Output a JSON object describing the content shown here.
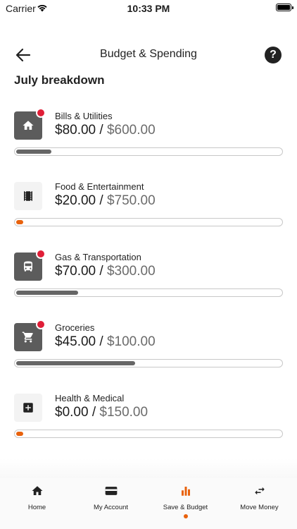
{
  "status_bar": {
    "carrier": "Carrier",
    "time": "10:33 PM"
  },
  "header": {
    "title": "Budget & Spending",
    "back_icon": "arrow-left-icon",
    "help_label": "?"
  },
  "section_title": "July breakdown",
  "colors": {
    "accent": "#e8620d",
    "fill_dark": "#666666",
    "alert": "#e01e37",
    "icon_dark_bg": "#5c5c5c",
    "icon_light_bg": "#f3f3f3"
  },
  "budgets": [
    {
      "name": "Bills & Utilities",
      "spent": "$80.00",
      "separator": " / ",
      "limit": "$600.00",
      "icon": "home-icon",
      "icon_style": "dark",
      "alert": true,
      "progress": 0.133
    },
    {
      "name": "Food & Entertainment",
      "spent": "$20.00",
      "separator": " / ",
      "limit": "$750.00",
      "icon": "film-icon",
      "icon_style": "light",
      "alert": false,
      "progress": 0.027
    },
    {
      "name": "Gas & Transportation",
      "spent": "$70.00",
      "separator": " / ",
      "limit": "$300.00",
      "icon": "bus-icon",
      "icon_style": "dark",
      "alert": true,
      "progress": 0.233
    },
    {
      "name": "Groceries",
      "spent": "$45.00",
      "separator": " / ",
      "limit": "$100.00",
      "icon": "cart-icon",
      "icon_style": "dark",
      "alert": true,
      "progress": 0.45
    },
    {
      "name": "Health & Medical",
      "spent": "$0.00",
      "separator": " / ",
      "limit": "$150.00",
      "icon": "medical-icon",
      "icon_style": "light",
      "alert": false,
      "progress": 0.0
    }
  ],
  "tabs": [
    {
      "label": "Home",
      "icon": "home-icon",
      "active": false
    },
    {
      "label": "My Account",
      "icon": "card-icon",
      "active": false
    },
    {
      "label": "Save & Budget",
      "icon": "bar-chart-icon",
      "active": true
    },
    {
      "label": "Move Money",
      "icon": "transfer-icon",
      "active": false
    }
  ]
}
